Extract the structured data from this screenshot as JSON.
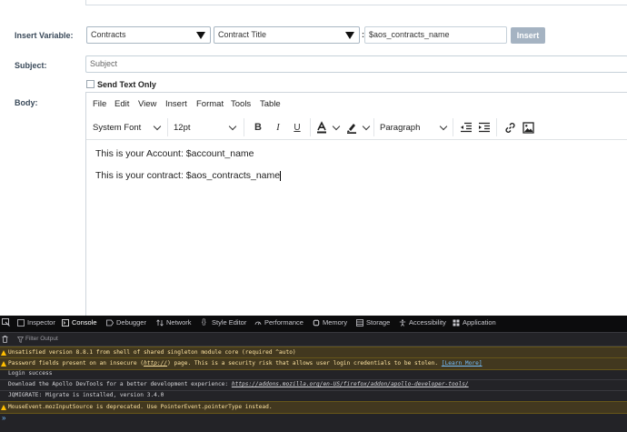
{
  "form": {
    "insert_variable_label": "Insert Variable:",
    "module_select": "Contracts",
    "field_select": "Contract Title",
    "separator": ":",
    "variable_value": "$aos_contracts_name",
    "insert_button": "Insert",
    "subject_label": "Subject:",
    "subject_placeholder": "Subject",
    "send_text_only_label": "Send Text Only",
    "body_label": "Body:"
  },
  "editor": {
    "menu": [
      "File",
      "Edit",
      "View",
      "Insert",
      "Format",
      "Tools",
      "Table"
    ],
    "font_family": "System Font",
    "font_size": "12pt",
    "block_format": "Paragraph",
    "content": [
      "This is your Account: $account_name",
      "This is your contract: $aos_contracts_name"
    ]
  },
  "devtools": {
    "tabs": [
      "Inspector",
      "Console",
      "Debugger",
      "Network",
      "Style Editor",
      "Performance",
      "Memory",
      "Storage",
      "Accessibility",
      "Application"
    ],
    "active_tab": "Console",
    "filter_placeholder": "Filter Output",
    "logs": [
      {
        "level": "warn",
        "text": "Unsatisfied version 8.8.1 from shell of shared singleton module core (required ^auto)"
      },
      {
        "level": "warn",
        "text_before": "Password fields present on an insecure (",
        "text_code": "http://",
        "text_after": ") page. This is a security risk that allows user login credentials to be stolen.",
        "link": "[Learn More]"
      },
      {
        "level": "info",
        "text": "Login success"
      },
      {
        "level": "info",
        "text_before": "Download the Apollo DevTools for a better development experience: ",
        "text_link": "https://addons.mozilla.org/en-US/firefox/addon/apollo-developer-tools/"
      },
      {
        "level": "info",
        "text": "JQMIGRATE: Migrate is installed, version 3.4.0"
      },
      {
        "level": "warn",
        "text": "MouseEvent.mozInputSource is deprecated. Use PointerEvent.pointerType instead."
      }
    ],
    "prompt": "»"
  },
  "colors": {
    "insert_button_bg": "#a5b3c2",
    "devtools_bg": "#232327",
    "warn_bg": "#42381f",
    "warn_text": "#fce2a1",
    "link": "#75bfff"
  }
}
